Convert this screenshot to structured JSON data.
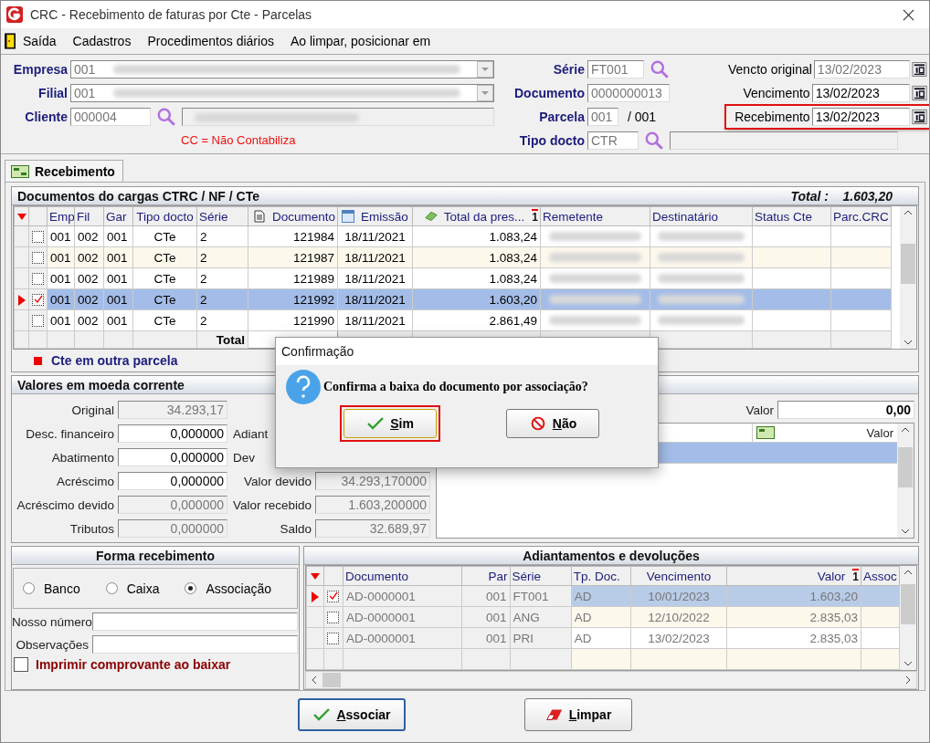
{
  "window": {
    "title": "CRC - Recebimento de faturas por Cte - Parcelas"
  },
  "menu": [
    "Saída",
    "Cadastros",
    "Procedimentos diários",
    "Ao limpar, posicionar em"
  ],
  "header": {
    "empresa": {
      "label": "Empresa",
      "value": "001"
    },
    "filial": {
      "label": "Filial",
      "value": "001"
    },
    "cliente": {
      "label": "Cliente",
      "value": "000004"
    },
    "note": "CC = Não Contabiliza",
    "serie": {
      "label": "Série",
      "value": "FT001"
    },
    "documento": {
      "label": "Documento",
      "value": "0000000013"
    },
    "parcela": {
      "label": "Parcela",
      "value": "001",
      "total": "/ 001"
    },
    "tipo_docto": {
      "label": "Tipo docto",
      "value": "CTR"
    },
    "dates": [
      {
        "label": "Vencto original",
        "value": "13/02/2023",
        "disabled": true,
        "highlighted": false
      },
      {
        "label": "Vencimento",
        "value": "13/02/2023",
        "disabled": false,
        "highlighted": false
      },
      {
        "label": "Recebimento",
        "value": "13/02/2023",
        "disabled": false,
        "highlighted": true
      }
    ]
  },
  "tabs": [
    {
      "label": "Recebimento",
      "selected": true
    }
  ],
  "documents": {
    "title": "Documentos do cargas CTRC / NF / CTe",
    "total_label": "Total :",
    "total": "1.603,20",
    "columns": [
      {
        "label": "Emp"
      },
      {
        "label": "Fil"
      },
      {
        "label": "Gar"
      },
      {
        "label": "Tipo docto"
      },
      {
        "label": "Série"
      },
      {
        "label": "Documento"
      },
      {
        "label": "Emissão"
      },
      {
        "label": "Total da pres...",
        "sort": "1"
      },
      {
        "label": "Remetente"
      },
      {
        "label": "Destinatário"
      },
      {
        "label": "Status Cte"
      },
      {
        "label": "Parc.CRC"
      }
    ],
    "rows": [
      {
        "selected": false,
        "checked": false,
        "cells": [
          "001",
          "002",
          "001",
          "CTe",
          "2",
          "121984",
          "18/11/2021",
          "1.083,24"
        ]
      },
      {
        "selected": false,
        "checked": false,
        "cells": [
          "001",
          "002",
          "001",
          "CTe",
          "2",
          "121987",
          "18/11/2021",
          "1.083,24"
        ]
      },
      {
        "selected": false,
        "checked": false,
        "cells": [
          "001",
          "002",
          "001",
          "CTe",
          "2",
          "121989",
          "18/11/2021",
          "1.083,24"
        ]
      },
      {
        "selected": true,
        "checked": true,
        "cells": [
          "001",
          "002",
          "001",
          "CTe",
          "2",
          "121992",
          "18/11/2021",
          "1.603,20"
        ]
      },
      {
        "selected": false,
        "checked": false,
        "cells": [
          "001",
          "002",
          "001",
          "CTe",
          "2",
          "121990",
          "18/11/2021",
          "2.861,49"
        ]
      }
    ],
    "footer_label": "Total",
    "legend": "Cte em outra parcela"
  },
  "values": {
    "title": "Valores em moeda corrente",
    "left": [
      {
        "label": "Original",
        "value": "34.293,17",
        "disabled": true
      },
      {
        "label": "Desc. financeiro",
        "value": "0,000000",
        "disabled": false
      },
      {
        "label": "Abatimento",
        "value": "0,000000",
        "disabled": false
      },
      {
        "label": "Acréscimo",
        "value": "0,000000",
        "disabled": false
      },
      {
        "label": "Acréscimo devido",
        "value": "0,000000",
        "disabled": true
      },
      {
        "label": "Tributos",
        "value": "0,000000",
        "disabled": true
      }
    ],
    "middle": [
      {
        "label": "Adiant"
      },
      {
        "label": "Dev"
      },
      {
        "label": "Valor devido",
        "value": "34.293,170000",
        "disabled": true
      },
      {
        "label": "Valor recebido",
        "value": "1.603,200000",
        "disabled": true
      },
      {
        "label": "Saldo",
        "value": "32.689,97",
        "disabled": true
      }
    ],
    "right": {
      "label": "Valor",
      "value": "0,00",
      "column": "Valor"
    }
  },
  "dialog": {
    "title": "Confirmação",
    "message": "Confirma a baixa do documento por associação?",
    "buttons": [
      {
        "label": "Sim",
        "kind": "yes",
        "focused": true
      },
      {
        "label": "Não",
        "kind": "no",
        "focused": false
      }
    ]
  },
  "forma": {
    "title": "Forma recebimento",
    "options": [
      {
        "label": "Banco",
        "selected": false
      },
      {
        "label": "Caixa",
        "selected": false
      },
      {
        "label": "Associação",
        "selected": true
      }
    ],
    "fields": [
      {
        "label": "Nosso número"
      },
      {
        "label": "Observações"
      }
    ],
    "imprimir": {
      "label": "Imprimir comprovante ao baixar",
      "checked": false
    }
  },
  "adiantamentos": {
    "title": "Adiantamentos e devoluções",
    "columns": [
      {
        "label": "Documento"
      },
      {
        "label": "Par"
      },
      {
        "label": "Série"
      },
      {
        "label": "Tp. Doc."
      },
      {
        "label": "Vencimento"
      },
      {
        "label": "Valor",
        "sort": "1"
      },
      {
        "label": "Assoc"
      }
    ],
    "rows": [
      {
        "selected": true,
        "checked": true,
        "cells": [
          "AD-0000001",
          "001",
          "FT001",
          "AD",
          "10/01/2023",
          "1.603,20"
        ]
      },
      {
        "selected": false,
        "checked": false,
        "cells": [
          "AD-0000001",
          "001",
          "ANG",
          "AD",
          "12/10/2022",
          "2.835,03"
        ]
      },
      {
        "selected": false,
        "checked": false,
        "cells": [
          "AD-0000001",
          "001",
          "PRI",
          "AD",
          "13/02/2023",
          "2.835,03"
        ]
      }
    ]
  },
  "buttons": [
    {
      "label": "Associar",
      "kind": "associate",
      "focused": true
    },
    {
      "label": "Limpar",
      "kind": "clear",
      "focused": false
    }
  ]
}
